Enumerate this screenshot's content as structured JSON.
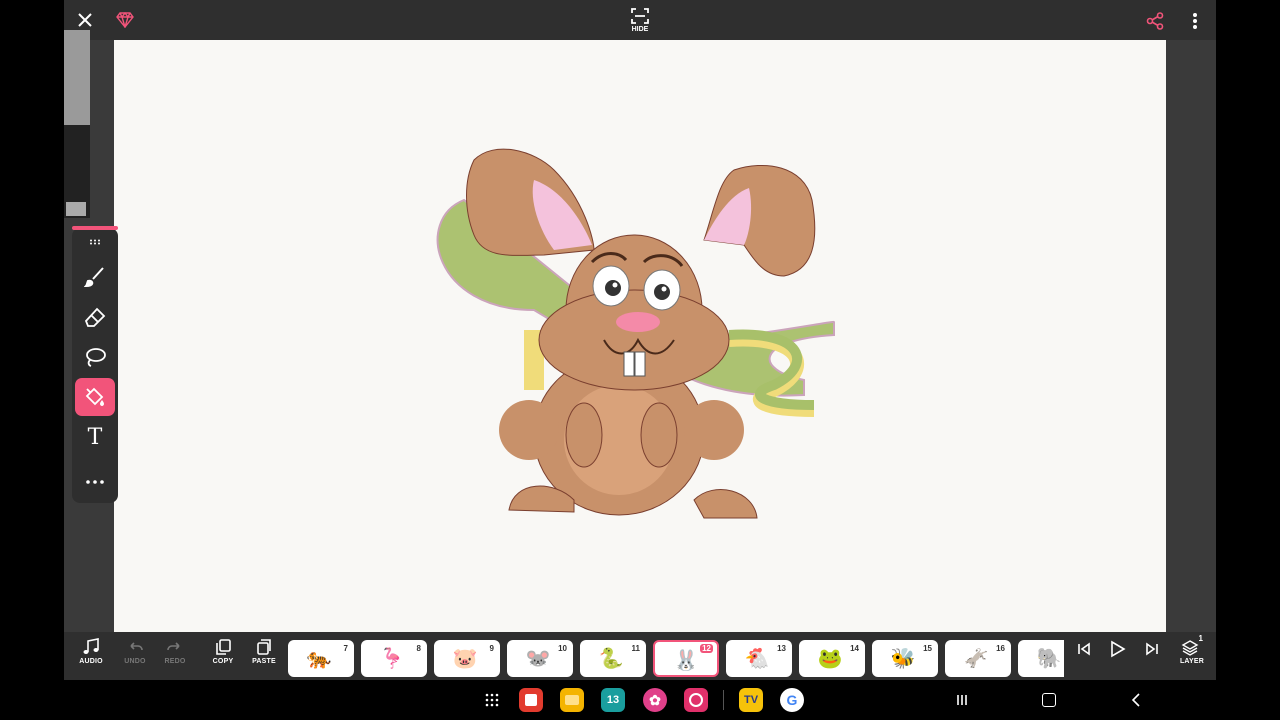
{
  "topbar": {
    "hide_label": "HIDE",
    "icons": {
      "close": "close-icon",
      "premium": "gem-icon",
      "hide": "hide-icon",
      "share": "share-icon",
      "more": "more-icon"
    }
  },
  "tools": [
    {
      "name": "brush",
      "icon": "brush-icon"
    },
    {
      "name": "eraser",
      "icon": "eraser-icon"
    },
    {
      "name": "lasso",
      "icon": "lasso-icon"
    },
    {
      "name": "fill",
      "icon": "fill-bucket-icon",
      "active": true
    },
    {
      "name": "text",
      "icon": "text-icon",
      "glyph": "T"
    },
    {
      "name": "more",
      "icon": "ellipsis-icon"
    }
  ],
  "bottombar": {
    "audio_label": "AUDIO",
    "undo_label": "UNDO",
    "redo_label": "REDO",
    "copy_label": "COPY",
    "paste_label": "PASTE",
    "layer_label": "LAYER",
    "layer_count": "1",
    "frames": [
      {
        "num": "7",
        "emoji": "🐅"
      },
      {
        "num": "8",
        "emoji": "🦩"
      },
      {
        "num": "9",
        "emoji": "🐷"
      },
      {
        "num": "10",
        "emoji": "🐭"
      },
      {
        "num": "11",
        "emoji": "🐍"
      },
      {
        "num": "12",
        "emoji": "🐰",
        "active": true
      },
      {
        "num": "13",
        "emoji": "🐔"
      },
      {
        "num": "14",
        "emoji": "🐸"
      },
      {
        "num": "15",
        "emoji": "🐝"
      },
      {
        "num": "16",
        "emoji": "🫏"
      },
      {
        "num": "",
        "emoji": "🐘"
      }
    ]
  },
  "navbar": {
    "calendar_day": "13",
    "tv_label": "TV",
    "google_label": "G"
  },
  "colors": {
    "accent": "#f2547a",
    "bar": "#2f2f2f",
    "canvas": "#f9f8f5"
  }
}
